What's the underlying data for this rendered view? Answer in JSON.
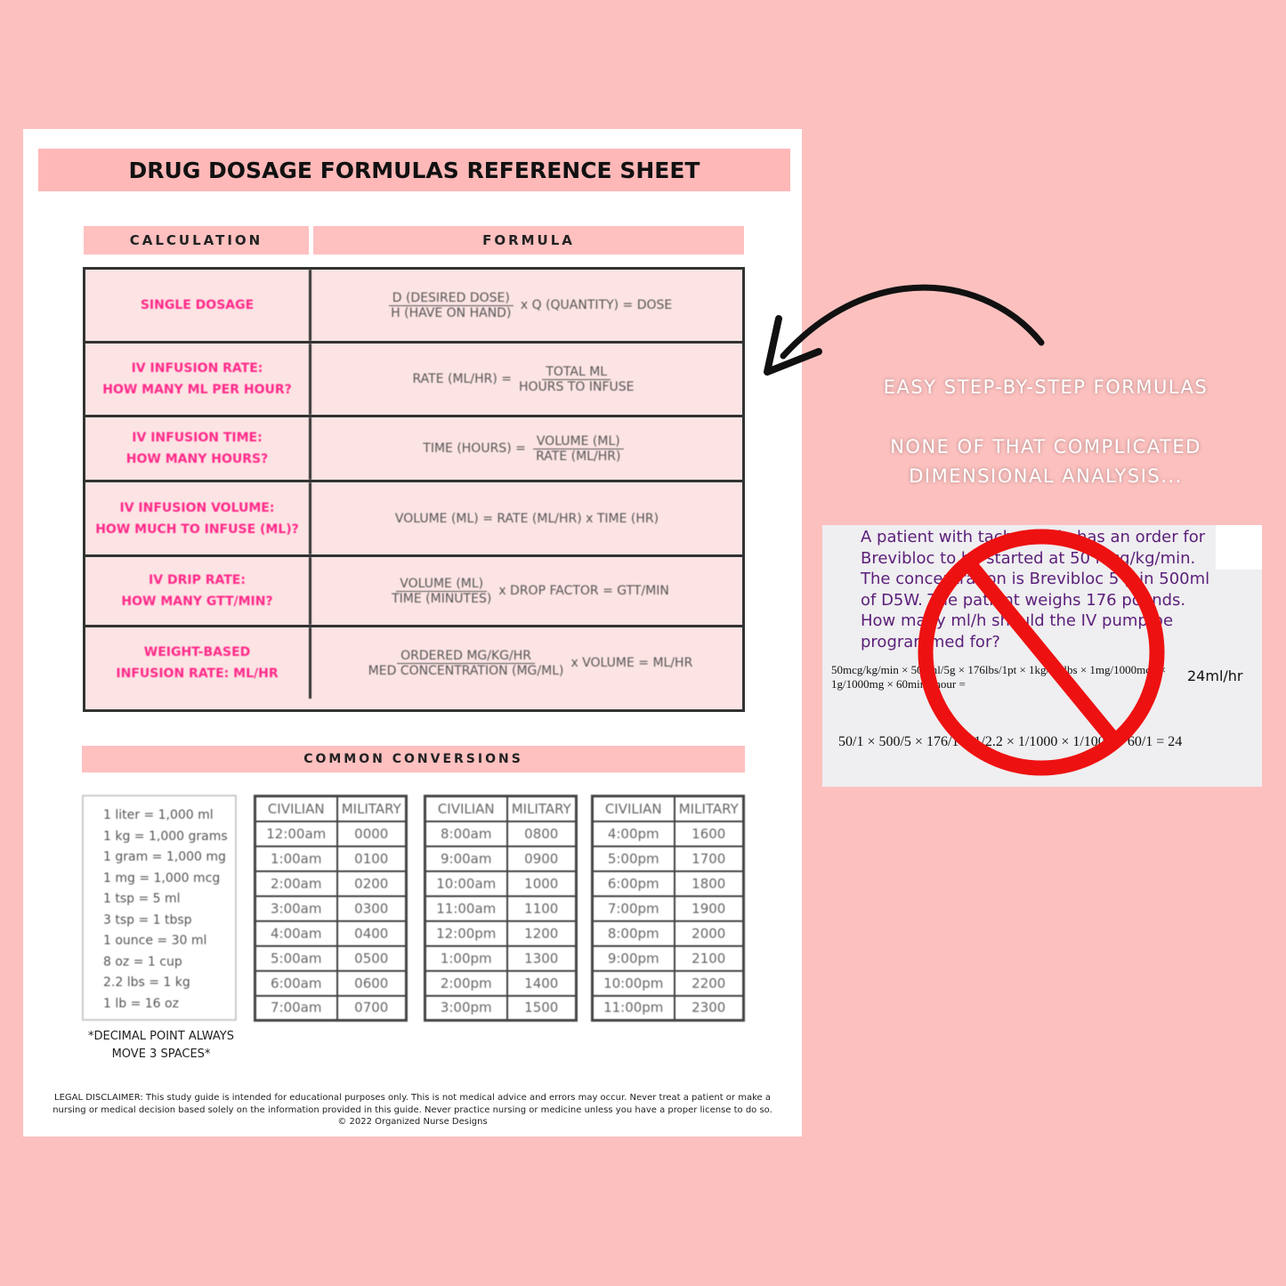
{
  "sheet": {
    "title": "DRUG DOSAGE FORMULAS REFERENCE SHEET",
    "headers": {
      "calculation": "CALCULATION",
      "formula": "FORMULA"
    },
    "formulas": [
      {
        "calc": [
          "SINGLE DOSAGE"
        ],
        "num": "D (DESIRED DOSE)",
        "den": "H (HAVE ON HAND)",
        "pre": "",
        "post": "x Q (QUANTITY) = DOSE"
      },
      {
        "calc": [
          "IV INFUSION RATE:",
          "HOW MANY ML PER HOUR?"
        ],
        "pre": "RATE (ML/HR) =",
        "num": "TOTAL ML",
        "den": "HOURS TO INFUSE",
        "post": ""
      },
      {
        "calc": [
          "IV INFUSION TIME:",
          "HOW MANY HOURS?"
        ],
        "pre": "TIME (HOURS) =",
        "num": "VOLUME (ML)",
        "den": "RATE (ML/HR)",
        "post": ""
      },
      {
        "calc": [
          "IV INFUSION VOLUME:",
          "HOW MUCH TO INFUSE (ML)?"
        ],
        "plain": "VOLUME (ML) = RATE (ML/HR) x TIME (HR)"
      },
      {
        "calc": [
          "IV DRIP RATE:",
          "HOW MANY GTT/MIN?"
        ],
        "pre": "",
        "num": "VOLUME (ML)",
        "den": "TIME (MINUTES)",
        "post": "x DROP FACTOR = GTT/MIN"
      },
      {
        "calc": [
          "WEIGHT-BASED",
          "INFUSION RATE: ML/HR"
        ],
        "pre": "",
        "num": "ORDERED MG/KG/HR",
        "den": "MED CONCENTRATION (MG/ML)",
        "post": "x VOLUME = ML/HR"
      }
    ],
    "conversions_title": "COMMON CONVERSIONS",
    "conversions": [
      "1 liter = 1,000 ml",
      "1 kg = 1,000 grams",
      "1 gram = 1,000 mg",
      "1 mg = 1,000 mcg",
      "1 tsp = 5 ml",
      "3 tsp = 1 tbsp",
      "1 ounce = 30 ml",
      "8 oz = 1 cup",
      "2.2 lbs = 1 kg",
      "1 lb = 16 oz"
    ],
    "note": [
      "*DECIMAL POINT ALWAYS",
      "MOVE 3 SPACES*"
    ],
    "time_headers": [
      "CIVILIAN",
      "MILITARY"
    ],
    "time_tables": [
      [
        [
          "12:00am",
          "0000"
        ],
        [
          "1:00am",
          "0100"
        ],
        [
          "2:00am",
          "0200"
        ],
        [
          "3:00am",
          "0300"
        ],
        [
          "4:00am",
          "0400"
        ],
        [
          "5:00am",
          "0500"
        ],
        [
          "6:00am",
          "0600"
        ],
        [
          "7:00am",
          "0700"
        ]
      ],
      [
        [
          "8:00am",
          "0800"
        ],
        [
          "9:00am",
          "0900"
        ],
        [
          "10:00am",
          "1000"
        ],
        [
          "11:00am",
          "1100"
        ],
        [
          "12:00pm",
          "1200"
        ],
        [
          "1:00pm",
          "1300"
        ],
        [
          "2:00pm",
          "1400"
        ],
        [
          "3:00pm",
          "1500"
        ]
      ],
      [
        [
          "4:00pm",
          "1600"
        ],
        [
          "5:00pm",
          "1700"
        ],
        [
          "6:00pm",
          "1800"
        ],
        [
          "7:00pm",
          "1900"
        ],
        [
          "8:00pm",
          "2000"
        ],
        [
          "9:00pm",
          "2100"
        ],
        [
          "10:00pm",
          "2200"
        ],
        [
          "11:00pm",
          "2300"
        ]
      ]
    ],
    "disclaimer": "LEGAL DISCLAIMER: This study guide is intended for educational purposes only. This is not medical advice and errors may occur. Never treat a patient or make a nursing or medical decision based solely on the information provided in this guide. Never practice nursing or medicine unless you have a proper license to do so.",
    "copyright": "© 2022 Organized Nurse Designs"
  },
  "promo": {
    "line1": "EASY STEP-BY-STEP FORMULAS",
    "line2": "NONE OF THAT COMPLICATED",
    "line3": "DIMENSIONAL ANALYSIS..."
  },
  "example": {
    "question": [
      "A patient with tachycardia has an order for",
      "Brevibloc to be started at 50 mcg/kg/min.",
      "The concentration is Brevibloc 5 g in 500ml",
      "of D5W. The patient weighs 176 pounds.",
      "How many ml/h should the IV pump be",
      "programmed for?"
    ],
    "equation": "50mcg/kg/min × 500ml/5g × 176lbs/1pt × 1kg/2.2lbs × 1mg/1000mcg × 1g/1000mg × 60min/1hour =",
    "answer": "24ml/hr",
    "equation2": "50/1 × 500/5 × 176/1 × 1/2.2 × 1/1000 × 1/1000 × 60/1 = 24"
  },
  "colors": {
    "background": "#fcc1bf",
    "accent_pink": "#ffb8b8",
    "calc_text": "#ff2a8a",
    "prohibition": "#ee1111"
  }
}
